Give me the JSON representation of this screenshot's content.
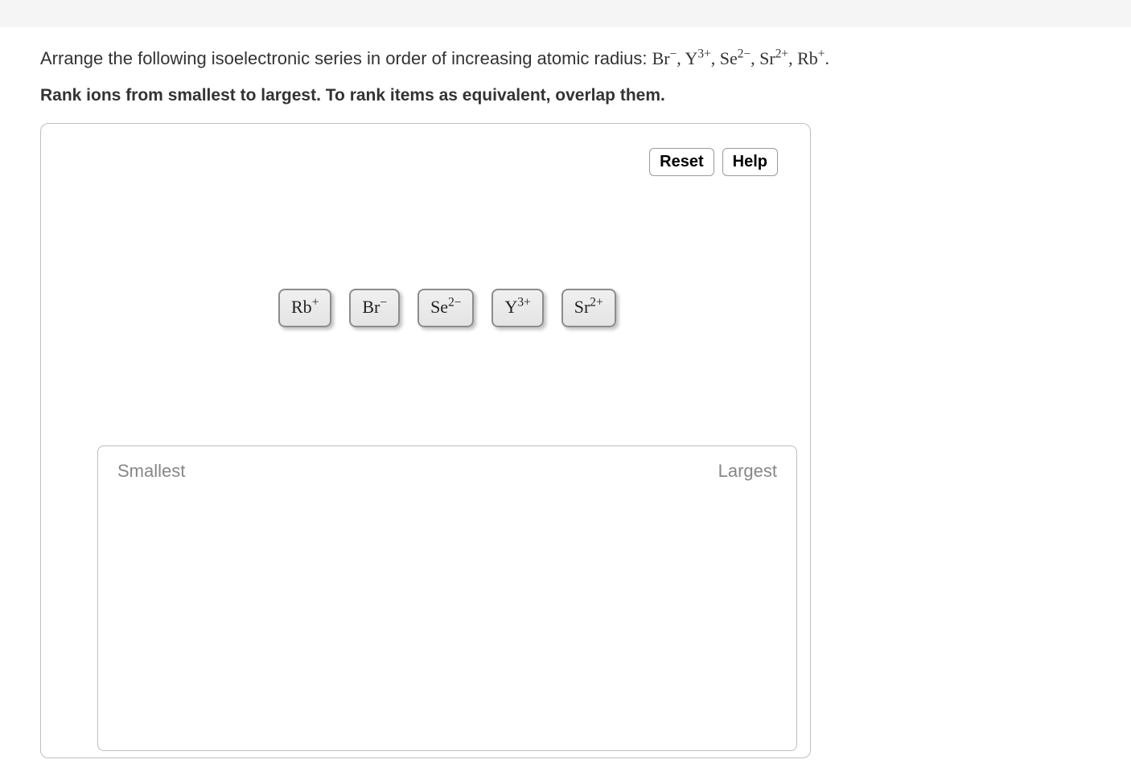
{
  "question": {
    "intro": "Arrange the following isoelectronic series in order of increasing atomic radius:",
    "series": [
      {
        "base": "Br",
        "sup": "−"
      },
      {
        "base": "Y",
        "sup": "3+"
      },
      {
        "base": "Se",
        "sup": "2−"
      },
      {
        "base": "Sr",
        "sup": "2+"
      },
      {
        "base": "Rb",
        "sup": "+"
      }
    ],
    "instruction": "Rank ions from smallest to largest. To rank items as equivalent, overlap them."
  },
  "buttons": {
    "reset": "Reset",
    "help": "Help"
  },
  "chips": [
    {
      "base": "Rb",
      "sup": "+"
    },
    {
      "base": "Br",
      "sup": "−"
    },
    {
      "base": "Se",
      "sup": "2−"
    },
    {
      "base": "Y",
      "sup": "3+"
    },
    {
      "base": "Sr",
      "sup": "2+"
    }
  ],
  "target": {
    "left": "Smallest",
    "right": "Largest"
  }
}
